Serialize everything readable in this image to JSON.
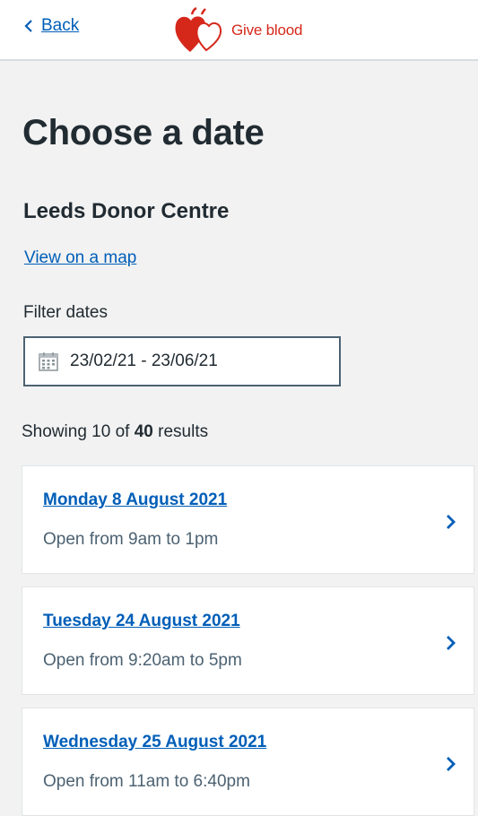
{
  "header": {
    "back_label": "Back",
    "logo_text": "Give blood",
    "logo_color": "#d5281b"
  },
  "page": {
    "title": "Choose a date",
    "centre_name": "Leeds Donor Centre",
    "map_link": "View on a map",
    "filter_label": "Filter dates",
    "date_range": "23/02/21 - 23/06/21"
  },
  "results": {
    "prefix": "Showing",
    "shown": "10",
    "of_word": "of",
    "total": "40",
    "suffix": "results"
  },
  "sessions": [
    {
      "date": "Monday 8 August 2021",
      "hours": "Open from 9am to 1pm"
    },
    {
      "date": "Tuesday 24 August 2021",
      "hours": "Open from 9:20am to 5pm"
    },
    {
      "date": "Wednesday 25 August 2021",
      "hours": "Open from 11am to 6:40pm"
    }
  ],
  "icons": {
    "back": "chevron-left-icon",
    "logo": "hearts-logo",
    "calendar": "calendar-icon",
    "card_arrow": "chevron-right-icon"
  },
  "colors": {
    "link": "#005eb8",
    "text": "#212b32",
    "secondary_text": "#4c6272",
    "background": "#f2f2f2",
    "brand_red": "#d5281b"
  }
}
